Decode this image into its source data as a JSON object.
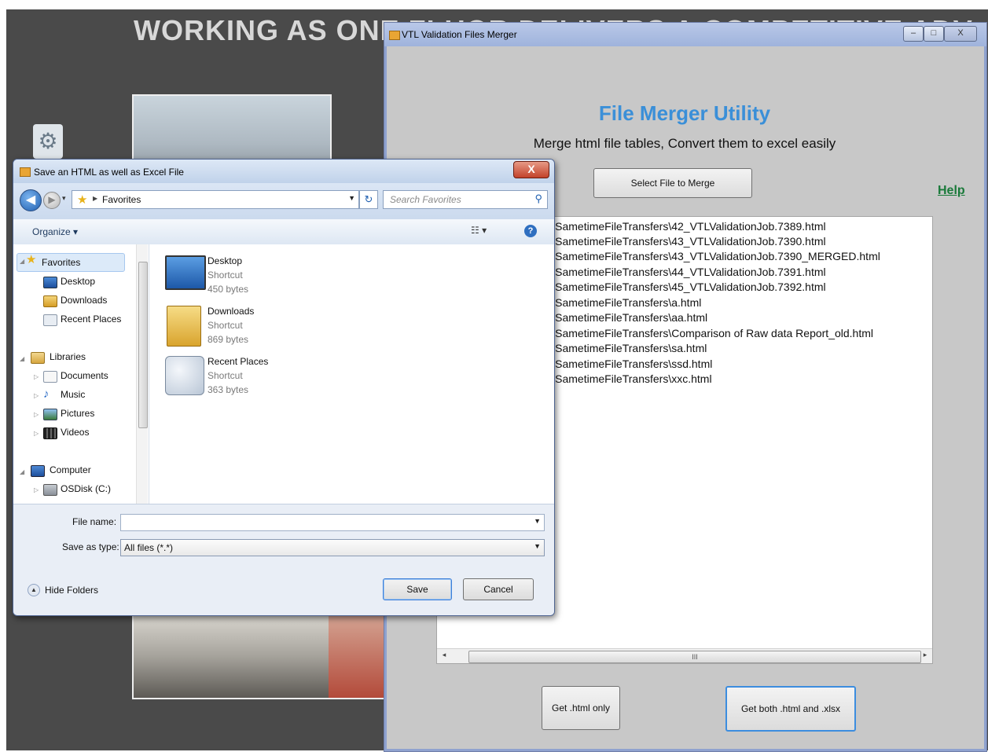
{
  "slide": {
    "heading": "WORKING AS ONE FLUOR DELIVERS A COMPETITIVE ADV"
  },
  "vtl_window": {
    "title": "VTL Validation Files Merger",
    "caption_min": "–",
    "caption_max": "□",
    "caption_close": "X",
    "heading": "File Merger Utility",
    "subheading": "Merge html file tables, Convert them to excel easily",
    "select_button": "Select File to Merge",
    "help_link": "Help",
    "files": [
      "nents\\SametimeFileTransfers\\42_VTLValidationJob.7389.html",
      "nents\\SametimeFileTransfers\\43_VTLValidationJob.7390.html",
      "nents\\SametimeFileTransfers\\43_VTLValidationJob.7390_MERGED.html",
      "nents\\SametimeFileTransfers\\44_VTLValidationJob.7391.html",
      "nents\\SametimeFileTransfers\\45_VTLValidationJob.7392.html",
      "nents\\SametimeFileTransfers\\a.html",
      "nents\\SametimeFileTransfers\\aa.html",
      "nents\\SametimeFileTransfers\\Comparison of Raw data Report_old.html",
      "nents\\SametimeFileTransfers\\sa.html",
      "nents\\SametimeFileTransfers\\ssd.html",
      "nents\\SametimeFileTransfers\\xxc.html"
    ],
    "scroll_thumb_grip": "III",
    "get_html_button": "Get .html only",
    "get_both_button": "Get both .html and .xlsx"
  },
  "save_dialog": {
    "title": "Save an HTML as well as Excel File",
    "close": "X",
    "address": "Favorites",
    "search_placeholder": "Search Favorites",
    "organize": "Organize ▾",
    "nav": {
      "favorites": "Favorites",
      "desktop": "Desktop",
      "downloads": "Downloads",
      "recent_places": "Recent Places",
      "libraries": "Libraries",
      "documents": "Documents",
      "music": "Music",
      "pictures": "Pictures",
      "videos": "Videos",
      "computer": "Computer",
      "osdisk": "OSDisk (C:)"
    },
    "items": [
      {
        "name": "Desktop",
        "type": "Shortcut",
        "size": "450 bytes"
      },
      {
        "name": "Downloads",
        "type": "Shortcut",
        "size": "869 bytes"
      },
      {
        "name": "Recent Places",
        "type": "Shortcut",
        "size": "363 bytes"
      }
    ],
    "file_name_label": "File name:",
    "file_name_value": "",
    "save_type_label": "Save as type:",
    "save_type_value": "All files (*.*)",
    "hide_folders": "Hide Folders",
    "save_button": "Save",
    "cancel_button": "Cancel"
  }
}
